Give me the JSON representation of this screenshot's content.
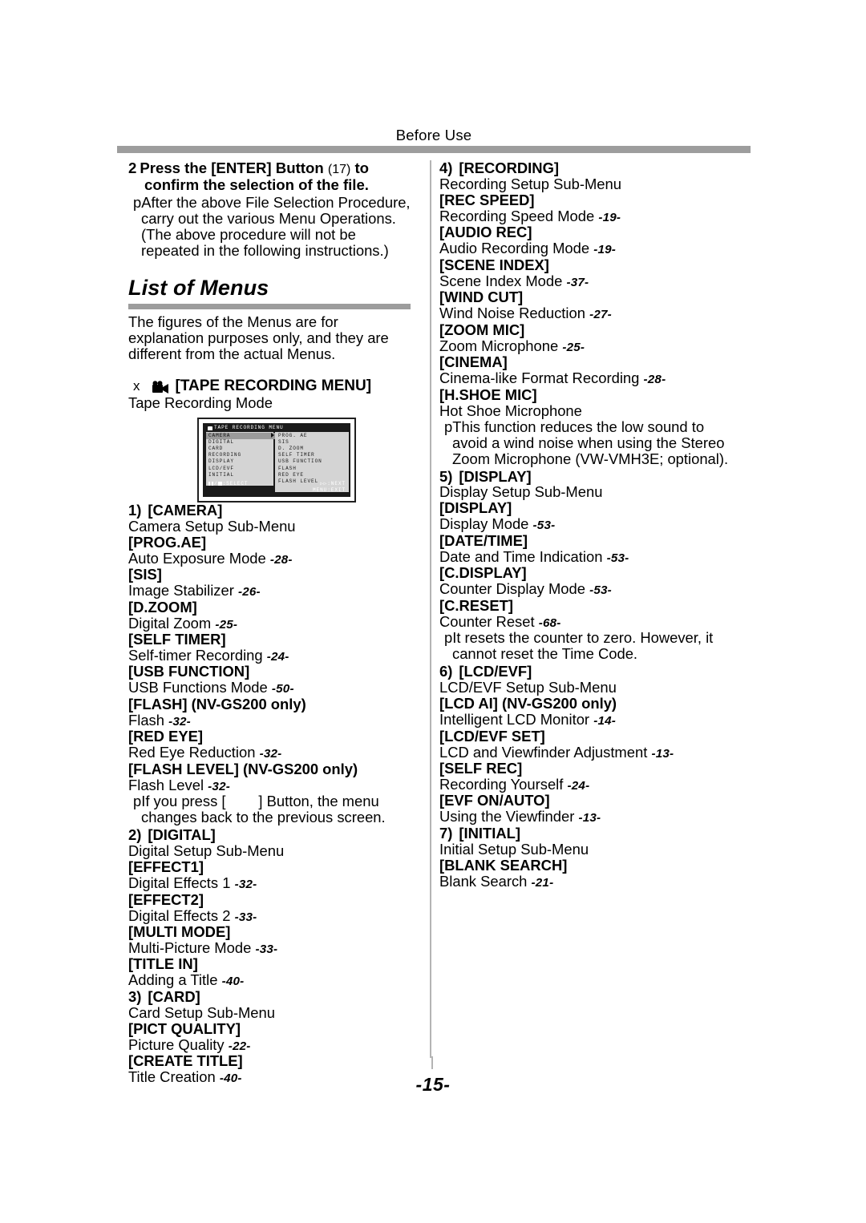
{
  "page": {
    "running_head": "Before Use",
    "folio": "-15-"
  },
  "left_column": {
    "step": {
      "number": "2",
      "text_before": "Press the [ENTER] Button",
      "ref": "(17)",
      "text_after": "to confirm the selection of the file."
    },
    "step_bullet": "pAfter the above File Selection Procedure, carry out the various Menu Operations. (The above procedure will not be repeated in the following instructions.)",
    "section_heading": "List of Menus",
    "section_intro": "The figures of the Menus are for explanation purposes only, and they are different from the actual Menus.",
    "menu_heading": {
      "xmark": "x",
      "icon": "camcorder-icon",
      "label": "[TAPE RECORDING MENU]",
      "subtitle": "Tape Recording Mode"
    },
    "osd": {
      "title": "TAPE RECORDING MENU",
      "left_items": [
        "CAMERA",
        "DIGITAL",
        "CARD",
        "RECORDING",
        "DISPLAY",
        "LCD/EVF",
        "INITIAL"
      ],
      "selected_index": 0,
      "right_items": [
        "PROG. AE",
        "SIS",
        "D. ZOOM",
        "SELF TIMER",
        "USB FUNCTION",
        "FLASH",
        "RED EYE",
        "FLASH LEVEL"
      ],
      "footer_left": ":SELECT",
      "footer_right_1": ":NEXT",
      "footer_right_2": "MENU:EXIT"
    },
    "groups": [
      {
        "number": "1)",
        "name": "[CAMERA]",
        "subtitle": "Camera Setup Sub-Menu",
        "entries": [
          {
            "key": "[PROG.AE]",
            "desc": "Auto Exposure Mode",
            "page": "-28-"
          },
          {
            "key": "[SIS]",
            "desc": "Image Stabilizer",
            "page": "-26-"
          },
          {
            "key": "[D.ZOOM]",
            "desc": "Digital Zoom",
            "page": "-25-"
          },
          {
            "key": "[SELF TIMER]",
            "desc": "Self-timer Recording",
            "page": "-24-"
          },
          {
            "key": "[USB FUNCTION]",
            "desc": "USB Functions Mode",
            "page": "-50-"
          },
          {
            "key": "[FLASH] (NV-GS200 only)",
            "desc": "Flash",
            "page": "-32-"
          },
          {
            "key": "[RED EYE]",
            "desc": "Red Eye Reduction",
            "page": "-32-"
          },
          {
            "key": "[FLASH LEVEL] (NV-GS200 only)",
            "desc": "Flash Level",
            "page": "-32-"
          }
        ],
        "note": "pIf you press [        ] Button, the menu changes back to the previous screen."
      },
      {
        "number": "2)",
        "name": "[DIGITAL]",
        "subtitle": "Digital Setup Sub-Menu",
        "entries": [
          {
            "key": "[EFFECT1]",
            "desc": "Digital Effects 1",
            "page": "-32-"
          },
          {
            "key": "[EFFECT2]",
            "desc": "Digital Effects 2",
            "page": "-33-"
          },
          {
            "key": "[MULTI MODE]",
            "desc": "Multi-Picture Mode",
            "page": "-33-"
          },
          {
            "key": "[TITLE IN]",
            "desc": "Adding a Title",
            "page": "-40-"
          }
        ],
        "note": ""
      },
      {
        "number": "3)",
        "name": "[CARD]",
        "subtitle": "Card Setup Sub-Menu",
        "entries": [
          {
            "key": "[PICT QUALITY]",
            "desc": "Picture Quality",
            "page": "-22-"
          },
          {
            "key": "[CREATE TITLE]",
            "desc": "Title Creation",
            "page": "-40-"
          }
        ],
        "note": ""
      }
    ]
  },
  "right_column": {
    "groups": [
      {
        "number": "4)",
        "name": "[RECORDING]",
        "subtitle": "Recording Setup Sub-Menu",
        "entries": [
          {
            "key": "[REC SPEED]",
            "desc": "Recording Speed Mode",
            "page": "-19-"
          },
          {
            "key": "[AUDIO REC]",
            "desc": "Audio Recording Mode",
            "page": "-19-"
          },
          {
            "key": "[SCENE INDEX]",
            "desc": "Scene Index Mode",
            "page": "-37-"
          },
          {
            "key": "[WIND CUT]",
            "desc": "Wind Noise Reduction",
            "page": "-27-"
          },
          {
            "key": "[ZOOM MIC]",
            "desc": "Zoom Microphone",
            "page": "-25-"
          },
          {
            "key": "[CINEMA]",
            "desc": "Cinema-like Format Recording",
            "page": "-28-"
          },
          {
            "key": "[H.SHOE MIC]",
            "desc": "Hot Shoe Microphone",
            "page": ""
          }
        ],
        "note": "pThis function reduces the low sound to avoid a wind noise when using the Stereo Zoom Microphone (VW-VMH3E; optional)."
      },
      {
        "number": "5)",
        "name": "[DISPLAY]",
        "subtitle": "Display Setup Sub-Menu",
        "entries": [
          {
            "key": "[DISPLAY]",
            "desc": "Display Mode",
            "page": "-53-"
          },
          {
            "key": "[DATE/TIME]",
            "desc": "Date and Time Indication",
            "page": "-53-"
          },
          {
            "key": "[C.DISPLAY]",
            "desc": "Counter Display Mode",
            "page": "-53-"
          },
          {
            "key": "[C.RESET]",
            "desc": "Counter Reset",
            "page": "-68-"
          }
        ],
        "note": "pIt resets the counter to zero. However, it cannot reset the Time Code."
      },
      {
        "number": "6)",
        "name": "[LCD/EVF]",
        "subtitle": "LCD/EVF Setup Sub-Menu",
        "entries": [
          {
            "key": "[LCD AI] (NV-GS200 only)",
            "desc": "Intelligent LCD Monitor",
            "page": "-14-"
          },
          {
            "key": "[LCD/EVF SET]",
            "desc": "LCD and Viewfinder Adjustment",
            "page": "-13-"
          },
          {
            "key": "[SELF REC]",
            "desc": "Recording Yourself",
            "page": "-24-"
          },
          {
            "key": "[EVF ON/AUTO]",
            "desc": "Using the Viewfinder",
            "page": "-13-"
          }
        ],
        "note": ""
      },
      {
        "number": "7)",
        "name": "[INITIAL]",
        "subtitle": "Initial Setup Sub-Menu",
        "entries": [
          {
            "key": "[BLANK SEARCH]",
            "desc": "Blank Search",
            "page": "-21-"
          }
        ],
        "note": ""
      }
    ]
  }
}
